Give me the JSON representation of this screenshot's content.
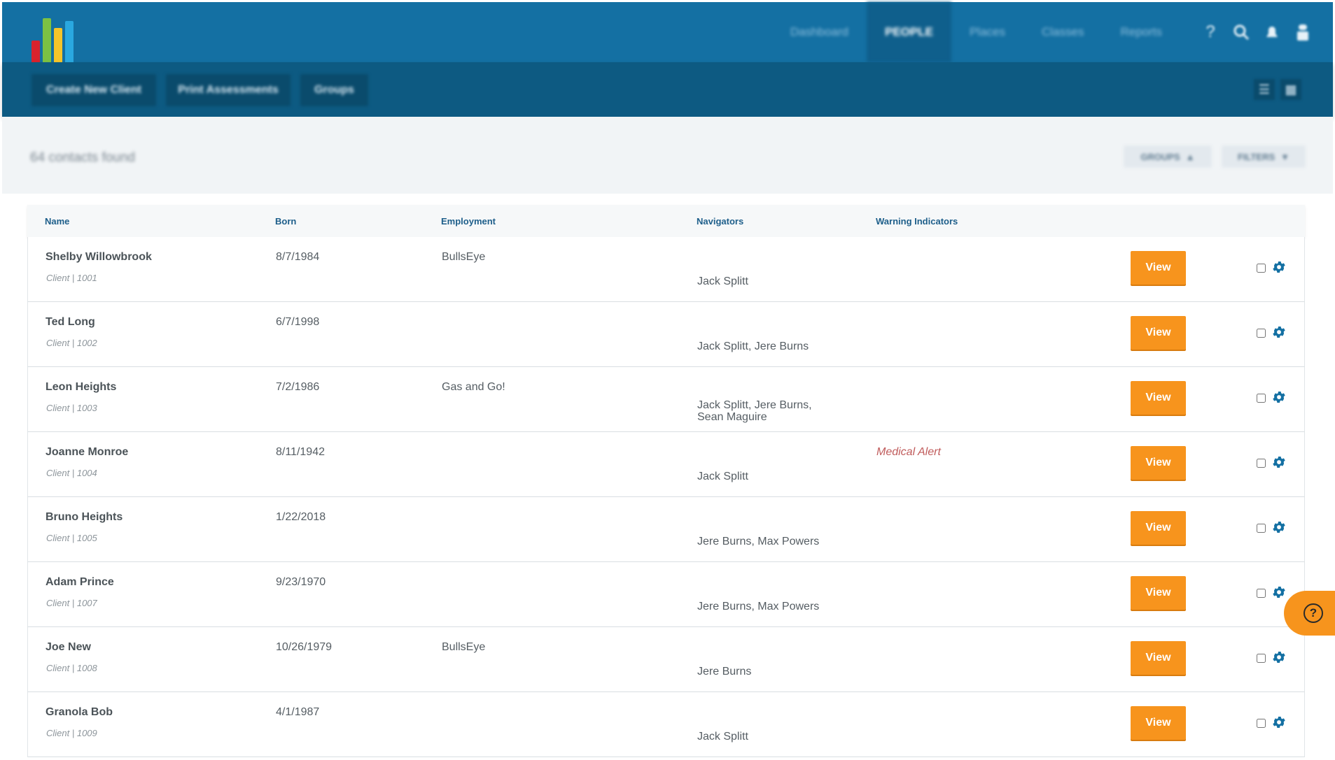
{
  "brand": {
    "logo_colors": [
      "#d9232d",
      "#7cc143",
      "#f5c52a",
      "#2aa8e0"
    ]
  },
  "nav": {
    "items": [
      {
        "label": "Dashboard",
        "active": false
      },
      {
        "label": "PEOPLE",
        "active": true
      },
      {
        "label": "Places",
        "active": false
      },
      {
        "label": "Classes",
        "active": false
      },
      {
        "label": "Reports",
        "active": false
      }
    ],
    "icons": [
      "help-icon",
      "search-icon",
      "notifications-icon",
      "user-icon"
    ]
  },
  "toolbar": {
    "create_label": "Create New Client",
    "print_label": "Print Assessments",
    "groups_label": "Groups",
    "icons": [
      "list-view-icon",
      "grid-view-icon"
    ]
  },
  "results": {
    "count_text": "64 contacts found",
    "groups_label": "GROUPS",
    "filters_label": "FILTERS"
  },
  "table": {
    "headers": {
      "name": "Name",
      "born": "Born",
      "employment": "Employment",
      "navigators": "Navigators",
      "warnings": "Warning Indicators"
    },
    "view_label": "View",
    "rows": [
      {
        "name": "Shelby Willowbrook",
        "sub": "Client | 1001",
        "born": "8/7/1984",
        "employment": "BullsEye",
        "navigators": "Jack Splitt",
        "warning": ""
      },
      {
        "name": "Ted Long",
        "sub": "Client | 1002",
        "born": "6/7/1998",
        "employment": "",
        "navigators": "Jack Splitt, Jere Burns",
        "warning": ""
      },
      {
        "name": "Leon Heights",
        "sub": "Client | 1003",
        "born": "7/2/1986",
        "employment": "Gas and Go!",
        "navigators": "Jack Splitt, Jere Burns, Sean Maguire",
        "warning": ""
      },
      {
        "name": "Joanne Monroe",
        "sub": "Client | 1004",
        "born": "8/11/1942",
        "employment": "",
        "navigators": "Jack Splitt",
        "warning": "Medical Alert"
      },
      {
        "name": "Bruno Heights",
        "sub": "Client | 1005",
        "born": "1/22/2018",
        "employment": "",
        "navigators": "Jere Burns, Max Powers",
        "warning": ""
      },
      {
        "name": "Adam Prince",
        "sub": "Client | 1007",
        "born": "9/23/1970",
        "employment": "",
        "navigators": "Jere Burns, Max Powers",
        "warning": ""
      },
      {
        "name": "Joe New",
        "sub": "Client | 1008",
        "born": "10/26/1979",
        "employment": "BullsEye",
        "navigators": "Jere Burns",
        "warning": ""
      },
      {
        "name": "Granola Bob",
        "sub": "Client | 1009",
        "born": "4/1/1987",
        "employment": "",
        "navigators": "Jack Splitt",
        "warning": ""
      }
    ]
  },
  "colors": {
    "topbar": "#1470a3",
    "subbar": "#0d5a82",
    "accent": "#f7941d",
    "header_text": "#1d5e8a",
    "gear": "#1470a3",
    "warning": "#c05b5b"
  }
}
